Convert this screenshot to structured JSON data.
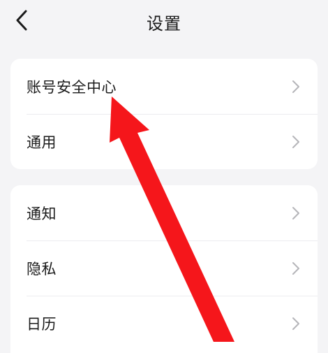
{
  "header": {
    "title": "设置"
  },
  "groups": [
    {
      "items": [
        {
          "label": "账号安全中心"
        },
        {
          "label": "通用"
        }
      ]
    },
    {
      "items": [
        {
          "label": "通知"
        },
        {
          "label": "隐私"
        },
        {
          "label": "日历"
        }
      ]
    }
  ],
  "colors": {
    "background": "#f4f4f6",
    "card": "#ffffff",
    "text": "#1a1a1a",
    "chevron": "#b5b5b9",
    "annotation_arrow": "#f5161b"
  },
  "icons": {
    "back": "back-arrow-icon",
    "chevron": "chevron-right-icon"
  }
}
